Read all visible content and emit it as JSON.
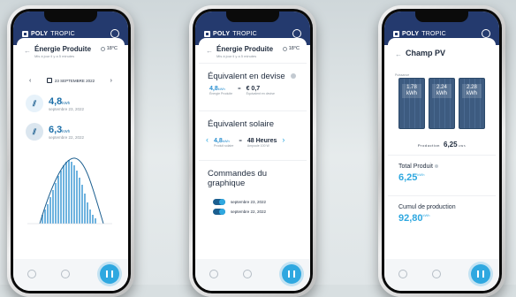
{
  "brand": {
    "name_bold": "POLY",
    "name_thin": "TROPIC"
  },
  "colors": {
    "header": "#243a6e",
    "accent": "#2fa8e0",
    "value_blue": "#1b6ea8"
  },
  "screen1": {
    "title": "Énergie Produite",
    "subtitle": "Mis à jour il y a 5 minutes",
    "temperature": "18°C",
    "date_prev": "‹",
    "date_label": "23 SEPTEMBRE 2022",
    "date_next": "›",
    "values": [
      {
        "value": "4,8",
        "unit": "kWh",
        "date": "septembre 23, 2022"
      },
      {
        "value": "6,3",
        "unit": "kWh",
        "date": "septembre 22, 2022"
      }
    ]
  },
  "screen2": {
    "title": "Énergie Produite",
    "subtitle": "Mis à jour il y a 5 minutes",
    "temperature": "18°C",
    "section1": "Équivalent en devise",
    "eq1": {
      "left_value": "4,8",
      "left_unit": "kWh",
      "left_label": "Énergie Produite",
      "op": "=",
      "right_value": "€ 0,7",
      "right_label": "Équivalent en devise"
    },
    "section2": "Équivalent solaire",
    "eq2": {
      "left_value": "4,8",
      "left_unit": "kWh",
      "left_label": "Produit solaire",
      "op": "=",
      "right_value": "48 Heures",
      "right_label": "Ampoule 100 W",
      "prev": "‹",
      "next": "›"
    },
    "section3": "Commandes du graphique",
    "legend": [
      "septembre 23, 2022",
      "septembre 22, 2022"
    ]
  },
  "screen3": {
    "title": "Champ PV",
    "pv_label": "Puissance",
    "panels": [
      {
        "value": "1.78",
        "unit": "kWh"
      },
      {
        "value": "2.24",
        "unit": "kWh"
      },
      {
        "value": "2.28",
        "unit": "kWh"
      }
    ],
    "production_label": "Production",
    "production_value": "6,25",
    "production_unit": "kWh",
    "total_label": "Total Produit",
    "total_value": "6,25",
    "total_unit": "kWh",
    "cumul_label": "Cumul de production",
    "cumul_value": "92,80",
    "cumul_unit": "kWh"
  }
}
